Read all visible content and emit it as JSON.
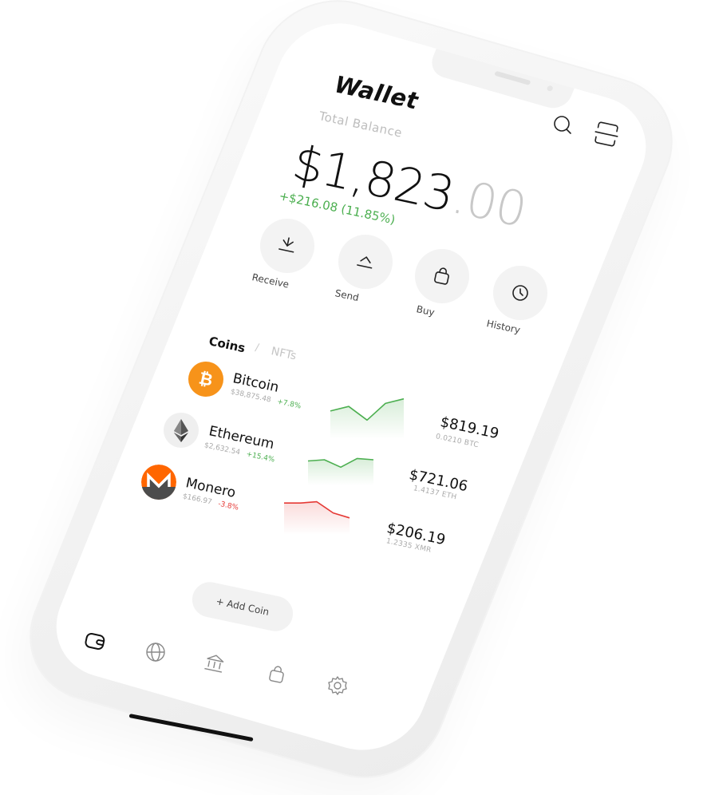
{
  "wallet": {
    "title": "Wallet",
    "balance_label": "Total Balance",
    "balance_main": "$1,823",
    "balance_cents": ".00",
    "change": "+$216.08 (11.85%)"
  },
  "actions": [
    {
      "label": "Receive",
      "icon": "receive-icon"
    },
    {
      "label": "Send",
      "icon": "send-icon"
    },
    {
      "label": "Buy",
      "icon": "shopping-bag-icon"
    },
    {
      "label": "History",
      "icon": "clock-icon"
    }
  ],
  "tabs": {
    "coins": "Coins",
    "separator": "/",
    "nfts": "NFTs"
  },
  "coins": [
    {
      "name": "Bitcoin",
      "price": "$38,875.48",
      "change": "+7.8%",
      "trend": "up",
      "value": "$819.19",
      "holding": "0.0210 BTC",
      "color": "#f7931a",
      "spark": [
        0.55,
        0.4,
        0.85,
        0.3,
        0.15
      ]
    },
    {
      "name": "Ethereum",
      "price": "$2,632.54",
      "change": "+15.4%",
      "trend": "up",
      "value": "$721.06",
      "holding": "1.4137 ETH",
      "color": "#4caf50",
      "spark": [
        0.5,
        0.45,
        0.75,
        0.4,
        0.45
      ]
    },
    {
      "name": "Monero",
      "price": "$166.97",
      "change": "-3.8%",
      "trend": "down",
      "value": "$206.19",
      "holding": "1.2335 XMR",
      "color": "#ff6600",
      "spark": [
        0.2,
        0.2,
        0.15,
        0.6,
        0.8
      ]
    }
  ],
  "add_coin": "+ Add Coin",
  "nav": [
    "wallet-icon",
    "globe-icon",
    "bank-icon",
    "shopping-bag-icon",
    "gear-icon"
  ],
  "colors": {
    "accent_green": "#4caf50",
    "accent_red": "#e53935",
    "bitcoin_orange": "#f7931a",
    "monero_orange": "#ff6600"
  }
}
